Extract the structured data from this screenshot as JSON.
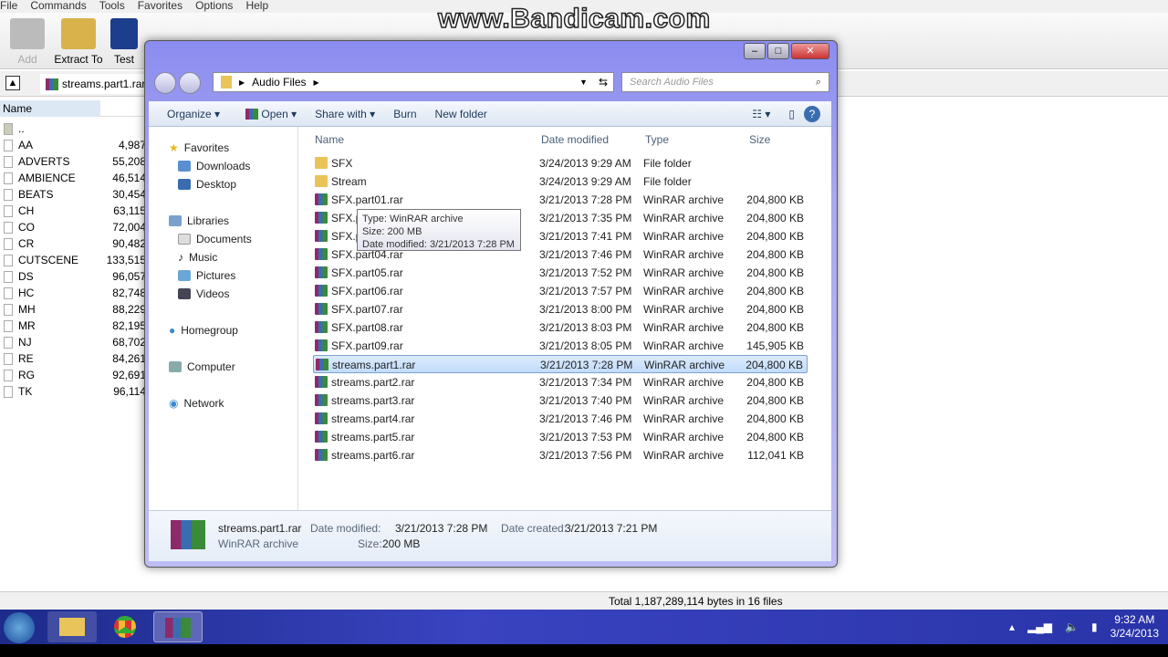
{
  "watermark": "www.Bandicam.com",
  "winrar": {
    "menu": [
      "File",
      "Commands",
      "Tools",
      "Favorites",
      "Options",
      "Help"
    ],
    "toolbar": {
      "add": "Add",
      "extract_to": "Extract To",
      "test": "Test"
    },
    "archive": "streams.part1.rar",
    "column_name": "Name",
    "up_item": "..",
    "items": [
      {
        "name": "AA",
        "size": "4,987"
      },
      {
        "name": "ADVERTS",
        "size": "55,208"
      },
      {
        "name": "AMBIENCE",
        "size": "46,514"
      },
      {
        "name": "BEATS",
        "size": "30,454"
      },
      {
        "name": "CH",
        "size": "63,115"
      },
      {
        "name": "CO",
        "size": "72,004"
      },
      {
        "name": "CR",
        "size": "90,482"
      },
      {
        "name": "CUTSCENE",
        "size": "133,515"
      },
      {
        "name": "DS",
        "size": "96,057"
      },
      {
        "name": "HC",
        "size": "82,748"
      },
      {
        "name": "MH",
        "size": "88,229"
      },
      {
        "name": "MR",
        "size": "82,195"
      },
      {
        "name": "NJ",
        "size": "68,702"
      },
      {
        "name": "RE",
        "size": "84,261"
      },
      {
        "name": "RG",
        "size": "92,691"
      },
      {
        "name": "TK",
        "size": "96,114"
      }
    ],
    "status": "Total 1,187,289,114 bytes in 16 files"
  },
  "explorer": {
    "path": "Audio Files",
    "search_placeholder": "Search Audio Files",
    "commands": {
      "organize": "Organize",
      "open": "Open",
      "share": "Share with",
      "burn": "Burn",
      "new_folder": "New folder"
    },
    "nav": {
      "favorites": "Favorites",
      "downloads": "Downloads",
      "desktop": "Desktop",
      "libraries": "Libraries",
      "documents": "Documents",
      "music": "Music",
      "pictures": "Pictures",
      "videos": "Videos",
      "homegroup": "Homegroup",
      "computer": "Computer",
      "network": "Network"
    },
    "columns": {
      "name": "Name",
      "date": "Date modified",
      "type": "Type",
      "size": "Size"
    },
    "files": [
      {
        "name": "SFX",
        "date": "3/24/2013 9:29 AM",
        "type": "File folder",
        "size": "",
        "icon": "folder"
      },
      {
        "name": "Stream",
        "date": "3/24/2013 9:29 AM",
        "type": "File folder",
        "size": "",
        "icon": "folder"
      },
      {
        "name": "SFX.part01.rar",
        "date": "3/21/2013 7:28 PM",
        "type": "WinRAR archive",
        "size": "204,800 KB",
        "icon": "rar"
      },
      {
        "name": "SFX.part02.rar",
        "date": "3/21/2013 7:35 PM",
        "type": "WinRAR archive",
        "size": "204,800 KB",
        "icon": "rar"
      },
      {
        "name": "SFX.part03.rar",
        "date": "3/21/2013 7:41 PM",
        "type": "WinRAR archive",
        "size": "204,800 KB",
        "icon": "rar"
      },
      {
        "name": "SFX.part04.rar",
        "date": "3/21/2013 7:46 PM",
        "type": "WinRAR archive",
        "size": "204,800 KB",
        "icon": "rar"
      },
      {
        "name": "SFX.part05.rar",
        "date": "3/21/2013 7:52 PM",
        "type": "WinRAR archive",
        "size": "204,800 KB",
        "icon": "rar"
      },
      {
        "name": "SFX.part06.rar",
        "date": "3/21/2013 7:57 PM",
        "type": "WinRAR archive",
        "size": "204,800 KB",
        "icon": "rar"
      },
      {
        "name": "SFX.part07.rar",
        "date": "3/21/2013 8:00 PM",
        "type": "WinRAR archive",
        "size": "204,800 KB",
        "icon": "rar"
      },
      {
        "name": "SFX.part08.rar",
        "date": "3/21/2013 8:03 PM",
        "type": "WinRAR archive",
        "size": "204,800 KB",
        "icon": "rar"
      },
      {
        "name": "SFX.part09.rar",
        "date": "3/21/2013 8:05 PM",
        "type": "WinRAR archive",
        "size": "145,905 KB",
        "icon": "rar"
      },
      {
        "name": "streams.part1.rar",
        "date": "3/21/2013 7:28 PM",
        "type": "WinRAR archive",
        "size": "204,800 KB",
        "icon": "rar",
        "selected": true
      },
      {
        "name": "streams.part2.rar",
        "date": "3/21/2013 7:34 PM",
        "type": "WinRAR archive",
        "size": "204,800 KB",
        "icon": "rar"
      },
      {
        "name": "streams.part3.rar",
        "date": "3/21/2013 7:40 PM",
        "type": "WinRAR archive",
        "size": "204,800 KB",
        "icon": "rar"
      },
      {
        "name": "streams.part4.rar",
        "date": "3/21/2013 7:46 PM",
        "type": "WinRAR archive",
        "size": "204,800 KB",
        "icon": "rar"
      },
      {
        "name": "streams.part5.rar",
        "date": "3/21/2013 7:53 PM",
        "type": "WinRAR archive",
        "size": "204,800 KB",
        "icon": "rar"
      },
      {
        "name": "streams.part6.rar",
        "date": "3/21/2013 7:56 PM",
        "type": "WinRAR archive",
        "size": "112,041 KB",
        "icon": "rar"
      }
    ],
    "tooltip": {
      "type": "Type: WinRAR archive",
      "size": "Size: 200 MB",
      "date": "Date modified: 3/21/2013 7:28 PM"
    },
    "details": {
      "name": "streams.part1.rar",
      "type": "WinRAR archive",
      "modified_label": "Date modified:",
      "modified": "3/21/2013 7:28 PM",
      "created_label": "Date created:",
      "created": "3/21/2013 7:21 PM",
      "size_label": "Size:",
      "size": "200 MB"
    }
  },
  "taskbar": {
    "time": "9:32 AM",
    "date": "3/24/2013"
  }
}
